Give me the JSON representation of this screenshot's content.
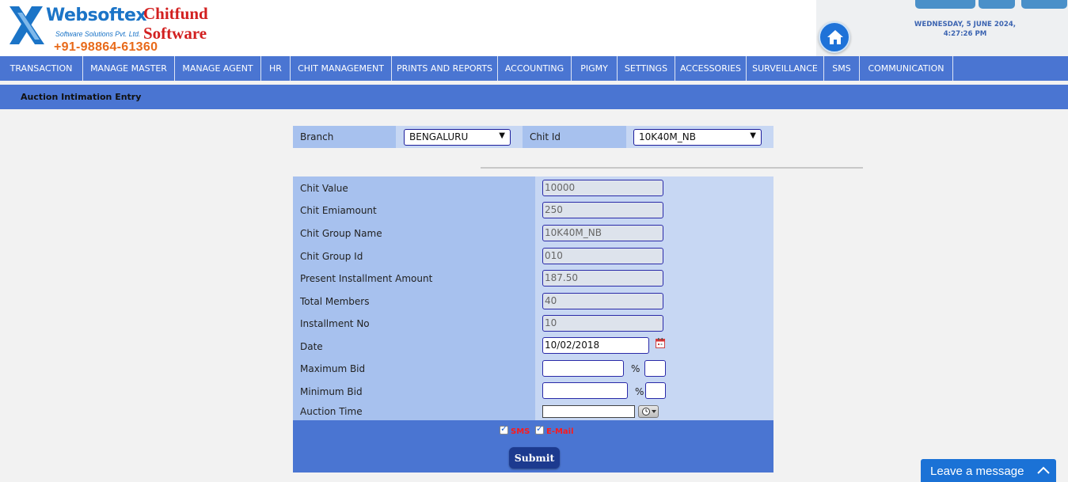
{
  "header": {
    "logo_name": "Websoftex",
    "logo_tagline": "Software Solutions Pvt. Ltd.",
    "logo_phone": "+91-98864-61360",
    "brand_line1": "Chitfund",
    "brand_line2": "Software",
    "date": "WEDNESDAY, 5 JUNE 2024,",
    "time": "4:27:26 PM",
    "home_icon": "home-icon",
    "accent": "#4a75d2"
  },
  "nav": {
    "items": [
      "TRANSACTION",
      "MANAGE MASTER",
      "MANAGE AGENT",
      "HR",
      "CHIT MANAGEMENT",
      "PRINTS AND REPORTS",
      "ACCOUNTING",
      "PIGMY",
      "SETTINGS",
      "ACCESSORIES",
      "SURVEILLANCE",
      "SMS",
      "COMMUNICATION"
    ]
  },
  "page": {
    "title": "Auction Intimation Entry"
  },
  "filters": {
    "branch_label": "Branch",
    "branch_value": "BENGALURU",
    "chit_id_label": "Chit Id",
    "chit_id_value": "10K40M_NB"
  },
  "form": {
    "chit_value_label": "Chit Value",
    "chit_value": "10000",
    "chit_emi_label": "Chit Emiamount",
    "chit_emi": "250",
    "group_name_label": "Chit Group Name",
    "group_name": "10K40M_NB",
    "group_id_label": "Chit Group Id",
    "group_id": "010",
    "present_amount_label": "Present Installment Amount",
    "present_amount": "187.50",
    "total_members_label": "Total Members",
    "total_members": "40",
    "installment_no_label": "Installment No",
    "installment_no": "10",
    "date_label": "Date",
    "date": "10/02/2018",
    "max_bid_label": "Maximum Bid",
    "max_bid": "",
    "min_bid_label": "Minimum Bid",
    "min_bid": "",
    "percent_sign": "%",
    "auction_time_label": "Auction Time",
    "auction_time": ""
  },
  "actions": {
    "sms_label": "SMS",
    "sms_checked": true,
    "email_label": "E-Mail",
    "email_checked": true,
    "submit_label": "Submit"
  },
  "chat": {
    "label": "Leave a message"
  }
}
